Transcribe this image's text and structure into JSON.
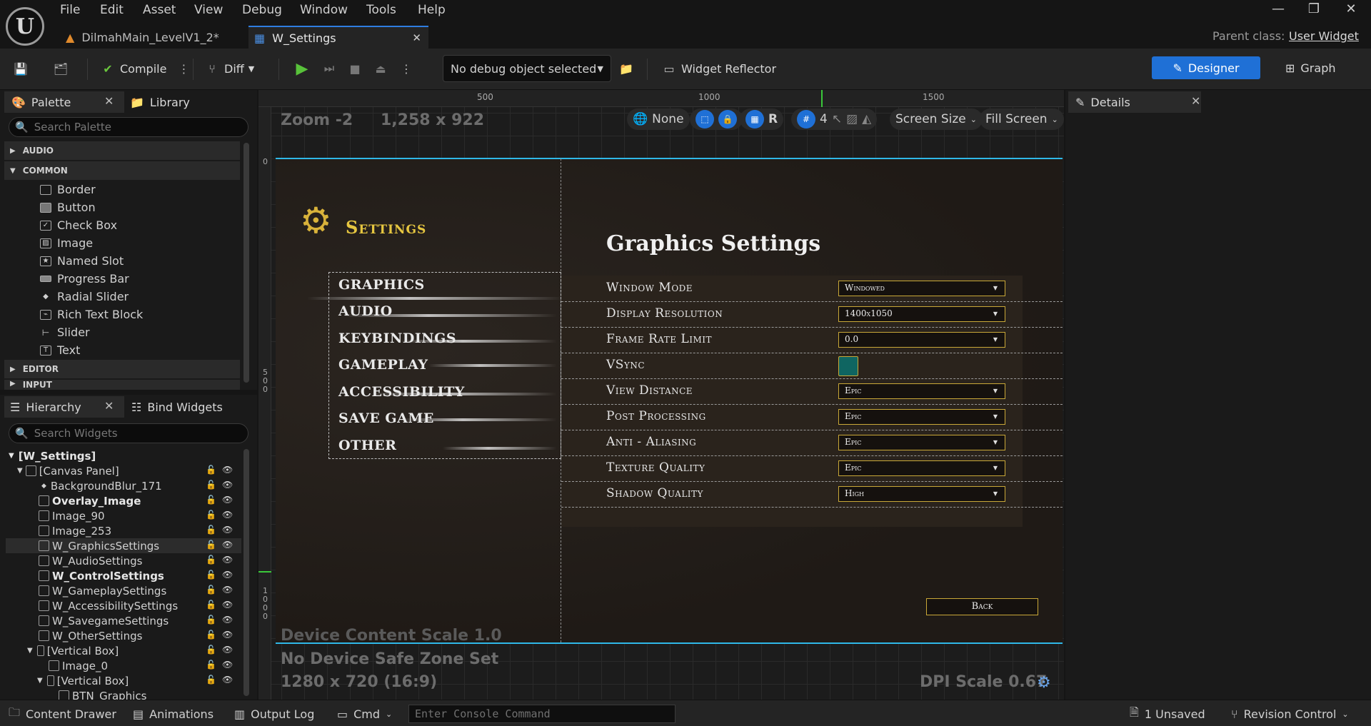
{
  "menu": [
    "File",
    "Edit",
    "Asset",
    "View",
    "Debug",
    "Window",
    "Tools",
    "Help"
  ],
  "tabs": [
    {
      "label": "DilmahMain_LevelV1_2*"
    },
    {
      "label": "W_Settings"
    }
  ],
  "parent_class": {
    "label": "Parent class:",
    "value": "User Widget"
  },
  "toolbar": {
    "compile": "Compile",
    "diff": "Diff",
    "debug_object": "No debug object selected",
    "widget_reflector": "Widget Reflector",
    "designer": "Designer",
    "graph": "Graph"
  },
  "palette": {
    "tab": "Palette",
    "library_tab": "Library",
    "search_placeholder": "Search Palette",
    "categories": [
      "AUDIO",
      "COMMON",
      "EDITOR",
      "INPUT"
    ],
    "common_items": [
      "Border",
      "Button",
      "Check Box",
      "Image",
      "Named Slot",
      "Progress Bar",
      "Radial Slider",
      "Rich Text Block",
      "Slider",
      "Text"
    ]
  },
  "hierarchy": {
    "tab": "Hierarchy",
    "bind_tab": "Bind Widgets",
    "search_placeholder": "Search Widgets",
    "rows": [
      "[W_Settings]",
      "[Canvas Panel]",
      "BackgroundBlur_171",
      "Overlay_Image",
      "Image_90",
      "Image_253",
      "W_GraphicsSettings",
      "W_AudioSettings",
      "W_ControlSettings",
      "W_GameplaySettings",
      "W_AccessibilitySettings",
      "W_SavegameSettings",
      "W_OtherSettings",
      "[Vertical Box]",
      "Image_0",
      "[Vertical Box]",
      "BTN_Graphics"
    ]
  },
  "viewport": {
    "zoom": "Zoom -2",
    "size": "1,258 x 922",
    "ruler_500": "500",
    "ruler_1000": "1000",
    "ruler_1500": "1500",
    "ruler_0": "0",
    "ruler_left_500": "5\n0\n0",
    "ruler_left_1000": "1\n0\n0\n0",
    "none": "None",
    "r_label": "R",
    "grid_num": "4",
    "screen_size": "Screen Size",
    "fill_screen": "Fill Screen",
    "device_scale": "Device Content Scale 1.0",
    "safe_zone": "No Device Safe Zone Set",
    "resolution": "1280 x 720 (16:9)",
    "dpi": "DPI Scale 0.67"
  },
  "game": {
    "settings_title": "Settings",
    "nav": [
      "GRAPHICS",
      "AUDIO",
      "KEYBINDINGS",
      "GAMEPLAY",
      "ACCESSIBILITY",
      "SAVE GAME",
      "OTHER"
    ],
    "graphics_title": "Graphics Settings",
    "rows": [
      {
        "label": "Window Mode",
        "value": "Windowed"
      },
      {
        "label": "Display Resolution",
        "value": "1400x1050"
      },
      {
        "label": "Frame Rate Limit",
        "value": "0.0"
      },
      {
        "label": "VSync",
        "value": ""
      },
      {
        "label": "View Distance",
        "value": "Epic"
      },
      {
        "label": "Post Processing",
        "value": "Epic"
      },
      {
        "label": "Anti - Aliasing",
        "value": "Epic"
      },
      {
        "label": "Texture Quality",
        "value": "Epic"
      },
      {
        "label": "Shadow Quality",
        "value": "High"
      }
    ],
    "back": "Back",
    "accent": "#c9a838",
    "vsync_color": "#0f6561"
  },
  "details": {
    "tab": "Details"
  },
  "bottombar": {
    "content_drawer": "Content Drawer",
    "animations": "Animations",
    "output_log": "Output Log",
    "cmd": "Cmd",
    "console_placeholder": "Enter Console Command",
    "unsaved": "1 Unsaved",
    "revision_control": "Revision Control"
  }
}
